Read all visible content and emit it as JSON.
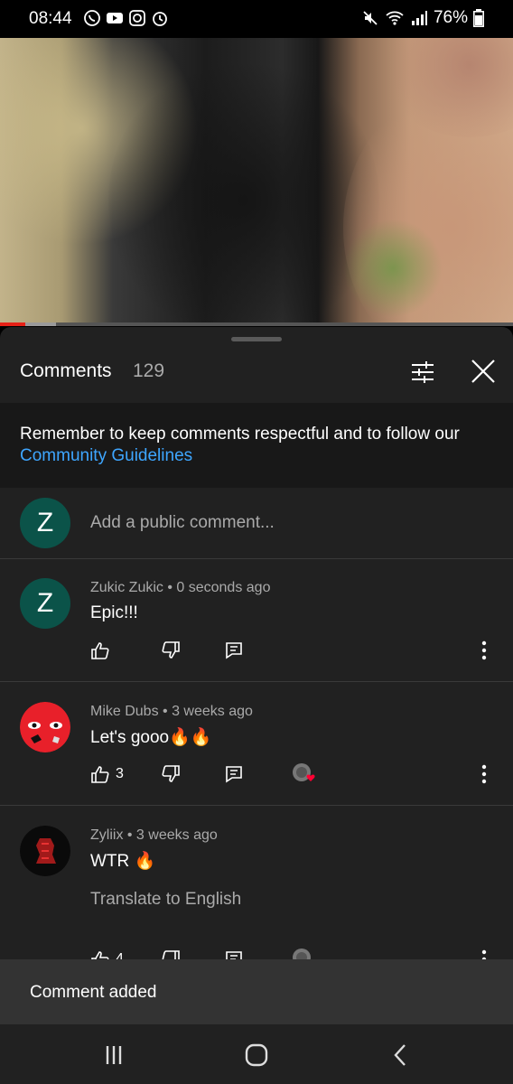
{
  "status_bar": {
    "time": "08:44",
    "battery": "76%"
  },
  "video": {
    "progress_fraction": 0.05,
    "buffered_fraction": 0.11
  },
  "header": {
    "title": "Comments",
    "count": "129"
  },
  "notice": {
    "text": "Remember to keep comments respectful and to follow our",
    "link": "Community Guidelines"
  },
  "composer": {
    "avatar_letter": "Z",
    "placeholder": "Add a public comment..."
  },
  "comments": [
    {
      "avatar_letter": "Z",
      "author": "Zukic Zukic",
      "time": "0 seconds ago",
      "meta": "Zukic Zukic • 0 seconds ago",
      "text": "Epic!!!",
      "likes": ""
    },
    {
      "author": "Mike Dubs",
      "time": "3 weeks ago",
      "meta": "Mike Dubs • 3 weeks ago",
      "text": "Let's gooo🔥🔥",
      "likes": "3"
    },
    {
      "author": "Zyliix",
      "time": "3 weeks ago",
      "meta": "Zyliix • 3 weeks ago",
      "text": "WTR 🔥",
      "translate": "Translate to English",
      "likes": "4"
    }
  ],
  "toast": {
    "message": "Comment added"
  },
  "colors": {
    "sheet_bg": "#212121",
    "link": "#3ea6ff",
    "progress": "#e62117",
    "avatar_green": "#0b5349"
  }
}
